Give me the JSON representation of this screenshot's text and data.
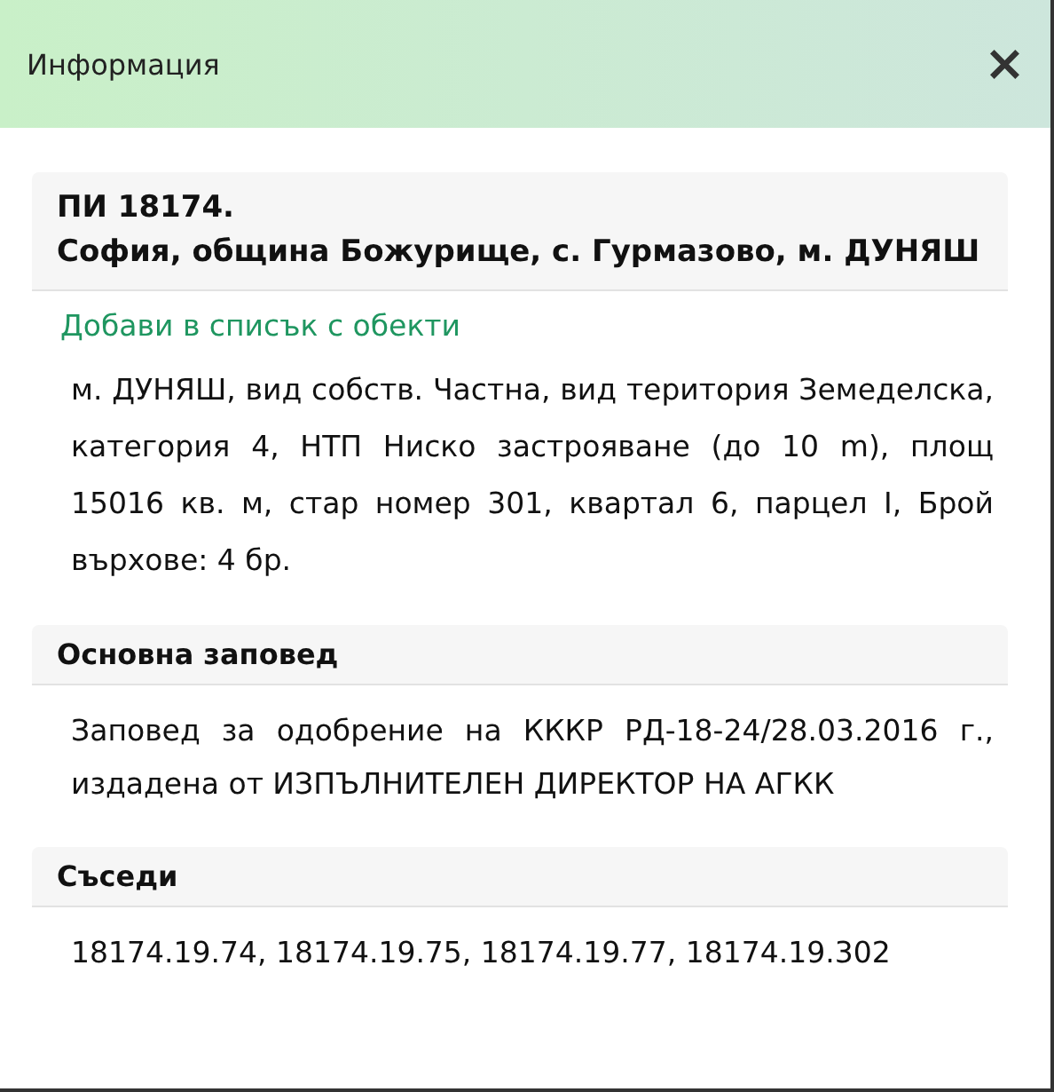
{
  "window": {
    "title": "Информация",
    "close": "×"
  },
  "parcel": {
    "title_parts": [
      "ПИ 18174.",
      "София, община Божурище, с. Гурмазово, м. ДУНЯШ"
    ],
    "link": "Добави в списък с обекти",
    "description": "м. ДУНЯШ, вид собств. Частна, вид територия Земеделска, категория 4, НТП Ниско застрояване (до 10 m), площ 15016 кв. м, стар номер 301, квартал 6, парцел I, Брой върхове: 4 бр."
  },
  "sections": [
    {
      "heading": "Основна заповед",
      "text": "Заповед за одобрение на КККР РД-18-24/28.03.2016 г., издадена от ИЗПЪЛНИТЕЛЕН ДИРЕКТОР НА АГКК"
    },
    {
      "heading": "Съседи",
      "text": "18174.19.74, 18174.19.75, 18174.19.77, 18174.19.302"
    }
  ]
}
